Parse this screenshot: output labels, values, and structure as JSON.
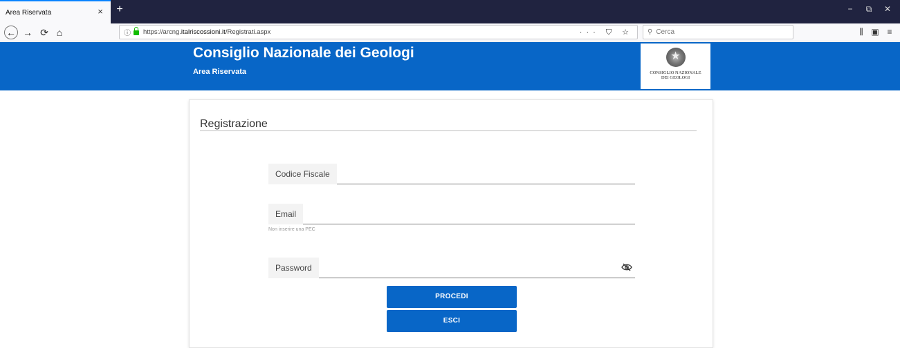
{
  "browser": {
    "tab_title": "Area Riservata",
    "tab_close": "×",
    "new_tab": "+",
    "window": {
      "minimize": "−",
      "restore": "⧉",
      "close": "✕"
    },
    "nav": {
      "back": "←",
      "forward": "→",
      "reload": "⟳",
      "home": "⌂"
    },
    "url_prefix": "https://arcng.",
    "url_domain": "italriscossioni.it",
    "url_path": "/Registrati.aspx",
    "url_actions": "··· ⛉ ☆",
    "search_placeholder": "Cerca",
    "toolbar_icons": {
      "library": "⫼",
      "sidebar": "▣",
      "menu": "≡"
    }
  },
  "header": {
    "title": "Consiglio Nazionale dei Geologi",
    "subtitle": "Area Riservata",
    "logo_line1": "CONSIGLIO NAZIONALE",
    "logo_line2": "DEI GEOLOGI"
  },
  "form": {
    "title": "Registrazione",
    "fields": {
      "codice_fiscale": {
        "label": "Codice Fiscale",
        "value": ""
      },
      "email": {
        "label": "Email",
        "value": "",
        "hint": "Non inserire una PEC"
      },
      "password": {
        "label": "Password",
        "value": ""
      }
    },
    "buttons": {
      "procedi": "PROCEDI",
      "esci": "ESCI"
    }
  },
  "colors": {
    "brand_blue": "#0866c7",
    "tabbar_dark": "#202340"
  }
}
